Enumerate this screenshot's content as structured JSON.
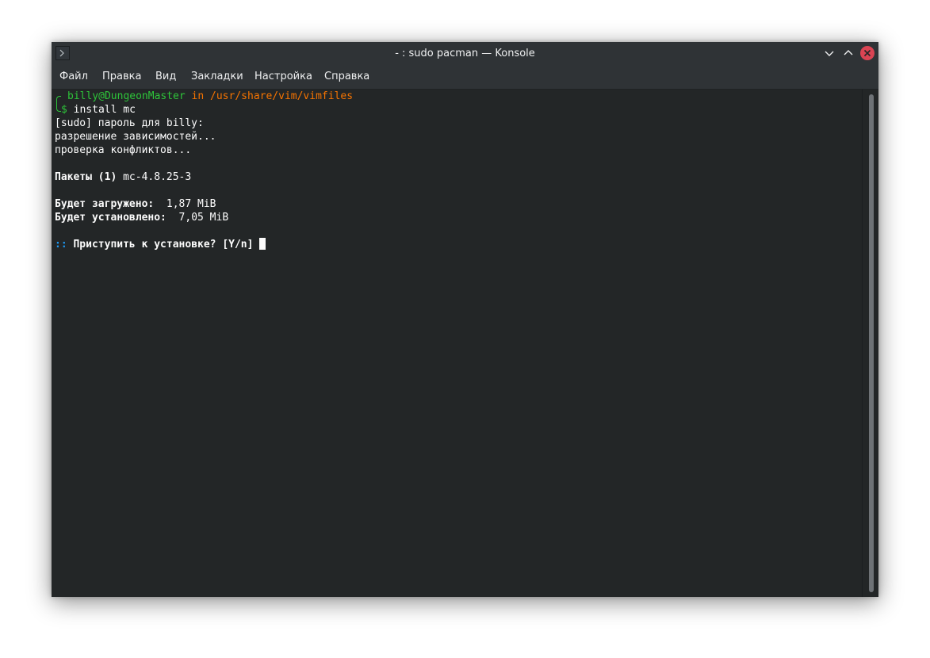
{
  "window": {
    "title": "- : sudo pacman — Konsole",
    "icon": "terminal-icon",
    "controls": [
      "minimize-icon",
      "maximize-icon",
      "close-icon"
    ]
  },
  "menubar": {
    "items": [
      "Файл",
      "Правка",
      "Вид",
      "Закладки",
      "Настройка",
      "Справка"
    ]
  },
  "terminal": {
    "prompt_user": "billy@DungeonMaster",
    "prompt_in": "in",
    "prompt_path": "/usr/share/vim/vimfiles",
    "prompt_symbol": "$",
    "command": " install mc",
    "sudo_prompt": "[sudo] пароль для billy:",
    "resolving": "разрешение зависимостей...",
    "checking": "проверка конфликтов...",
    "packages_label": "Пакеты (1)",
    "packages_value": " mc-4.8.25-3",
    "download_label": "Будет загружено:",
    "download_value": "  1,87 MiB",
    "install_label": "Будет установлено:",
    "install_value": "  7,05 MiB",
    "question_marker": "::",
    "question": " Приступить к установке? [Y/n] "
  },
  "colors": {
    "terminal_bg": "#232627",
    "prompt_green": "#2ec43a",
    "path_orange": "#f67400",
    "marker_blue": "#1d99f3",
    "close_red": "#da4453"
  }
}
